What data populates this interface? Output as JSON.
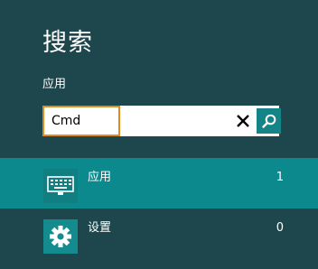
{
  "search": {
    "title": "搜索",
    "scope_label": "应用",
    "query": "Cmd"
  },
  "results": [
    {
      "label": "应用",
      "count": "1",
      "icon": "keyboard-icon",
      "selected": true
    },
    {
      "label": "设置",
      "count": "0",
      "icon": "gear-icon",
      "selected": false
    }
  ],
  "colors": {
    "background": "#1d474c",
    "selected_row": "#0c898d",
    "input_border": "#e08a22",
    "search_button": "#148487"
  }
}
